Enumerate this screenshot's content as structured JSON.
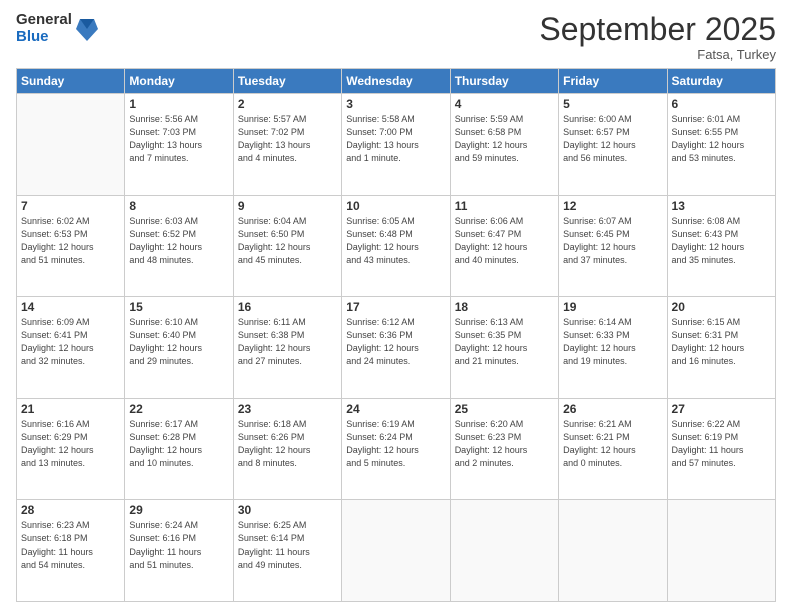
{
  "logo": {
    "general": "General",
    "blue": "Blue"
  },
  "title": "September 2025",
  "subtitle": "Fatsa, Turkey",
  "headers": [
    "Sunday",
    "Monday",
    "Tuesday",
    "Wednesday",
    "Thursday",
    "Friday",
    "Saturday"
  ],
  "weeks": [
    [
      {
        "day": "",
        "info": ""
      },
      {
        "day": "1",
        "info": "Sunrise: 5:56 AM\nSunset: 7:03 PM\nDaylight: 13 hours\nand 7 minutes."
      },
      {
        "day": "2",
        "info": "Sunrise: 5:57 AM\nSunset: 7:02 PM\nDaylight: 13 hours\nand 4 minutes."
      },
      {
        "day": "3",
        "info": "Sunrise: 5:58 AM\nSunset: 7:00 PM\nDaylight: 13 hours\nand 1 minute."
      },
      {
        "day": "4",
        "info": "Sunrise: 5:59 AM\nSunset: 6:58 PM\nDaylight: 12 hours\nand 59 minutes."
      },
      {
        "day": "5",
        "info": "Sunrise: 6:00 AM\nSunset: 6:57 PM\nDaylight: 12 hours\nand 56 minutes."
      },
      {
        "day": "6",
        "info": "Sunrise: 6:01 AM\nSunset: 6:55 PM\nDaylight: 12 hours\nand 53 minutes."
      }
    ],
    [
      {
        "day": "7",
        "info": "Sunrise: 6:02 AM\nSunset: 6:53 PM\nDaylight: 12 hours\nand 51 minutes."
      },
      {
        "day": "8",
        "info": "Sunrise: 6:03 AM\nSunset: 6:52 PM\nDaylight: 12 hours\nand 48 minutes."
      },
      {
        "day": "9",
        "info": "Sunrise: 6:04 AM\nSunset: 6:50 PM\nDaylight: 12 hours\nand 45 minutes."
      },
      {
        "day": "10",
        "info": "Sunrise: 6:05 AM\nSunset: 6:48 PM\nDaylight: 12 hours\nand 43 minutes."
      },
      {
        "day": "11",
        "info": "Sunrise: 6:06 AM\nSunset: 6:47 PM\nDaylight: 12 hours\nand 40 minutes."
      },
      {
        "day": "12",
        "info": "Sunrise: 6:07 AM\nSunset: 6:45 PM\nDaylight: 12 hours\nand 37 minutes."
      },
      {
        "day": "13",
        "info": "Sunrise: 6:08 AM\nSunset: 6:43 PM\nDaylight: 12 hours\nand 35 minutes."
      }
    ],
    [
      {
        "day": "14",
        "info": "Sunrise: 6:09 AM\nSunset: 6:41 PM\nDaylight: 12 hours\nand 32 minutes."
      },
      {
        "day": "15",
        "info": "Sunrise: 6:10 AM\nSunset: 6:40 PM\nDaylight: 12 hours\nand 29 minutes."
      },
      {
        "day": "16",
        "info": "Sunrise: 6:11 AM\nSunset: 6:38 PM\nDaylight: 12 hours\nand 27 minutes."
      },
      {
        "day": "17",
        "info": "Sunrise: 6:12 AM\nSunset: 6:36 PM\nDaylight: 12 hours\nand 24 minutes."
      },
      {
        "day": "18",
        "info": "Sunrise: 6:13 AM\nSunset: 6:35 PM\nDaylight: 12 hours\nand 21 minutes."
      },
      {
        "day": "19",
        "info": "Sunrise: 6:14 AM\nSunset: 6:33 PM\nDaylight: 12 hours\nand 19 minutes."
      },
      {
        "day": "20",
        "info": "Sunrise: 6:15 AM\nSunset: 6:31 PM\nDaylight: 12 hours\nand 16 minutes."
      }
    ],
    [
      {
        "day": "21",
        "info": "Sunrise: 6:16 AM\nSunset: 6:29 PM\nDaylight: 12 hours\nand 13 minutes."
      },
      {
        "day": "22",
        "info": "Sunrise: 6:17 AM\nSunset: 6:28 PM\nDaylight: 12 hours\nand 10 minutes."
      },
      {
        "day": "23",
        "info": "Sunrise: 6:18 AM\nSunset: 6:26 PM\nDaylight: 12 hours\nand 8 minutes."
      },
      {
        "day": "24",
        "info": "Sunrise: 6:19 AM\nSunset: 6:24 PM\nDaylight: 12 hours\nand 5 minutes."
      },
      {
        "day": "25",
        "info": "Sunrise: 6:20 AM\nSunset: 6:23 PM\nDaylight: 12 hours\nand 2 minutes."
      },
      {
        "day": "26",
        "info": "Sunrise: 6:21 AM\nSunset: 6:21 PM\nDaylight: 12 hours\nand 0 minutes."
      },
      {
        "day": "27",
        "info": "Sunrise: 6:22 AM\nSunset: 6:19 PM\nDaylight: 11 hours\nand 57 minutes."
      }
    ],
    [
      {
        "day": "28",
        "info": "Sunrise: 6:23 AM\nSunset: 6:18 PM\nDaylight: 11 hours\nand 54 minutes."
      },
      {
        "day": "29",
        "info": "Sunrise: 6:24 AM\nSunset: 6:16 PM\nDaylight: 11 hours\nand 51 minutes."
      },
      {
        "day": "30",
        "info": "Sunrise: 6:25 AM\nSunset: 6:14 PM\nDaylight: 11 hours\nand 49 minutes."
      },
      {
        "day": "",
        "info": ""
      },
      {
        "day": "",
        "info": ""
      },
      {
        "day": "",
        "info": ""
      },
      {
        "day": "",
        "info": ""
      }
    ]
  ]
}
